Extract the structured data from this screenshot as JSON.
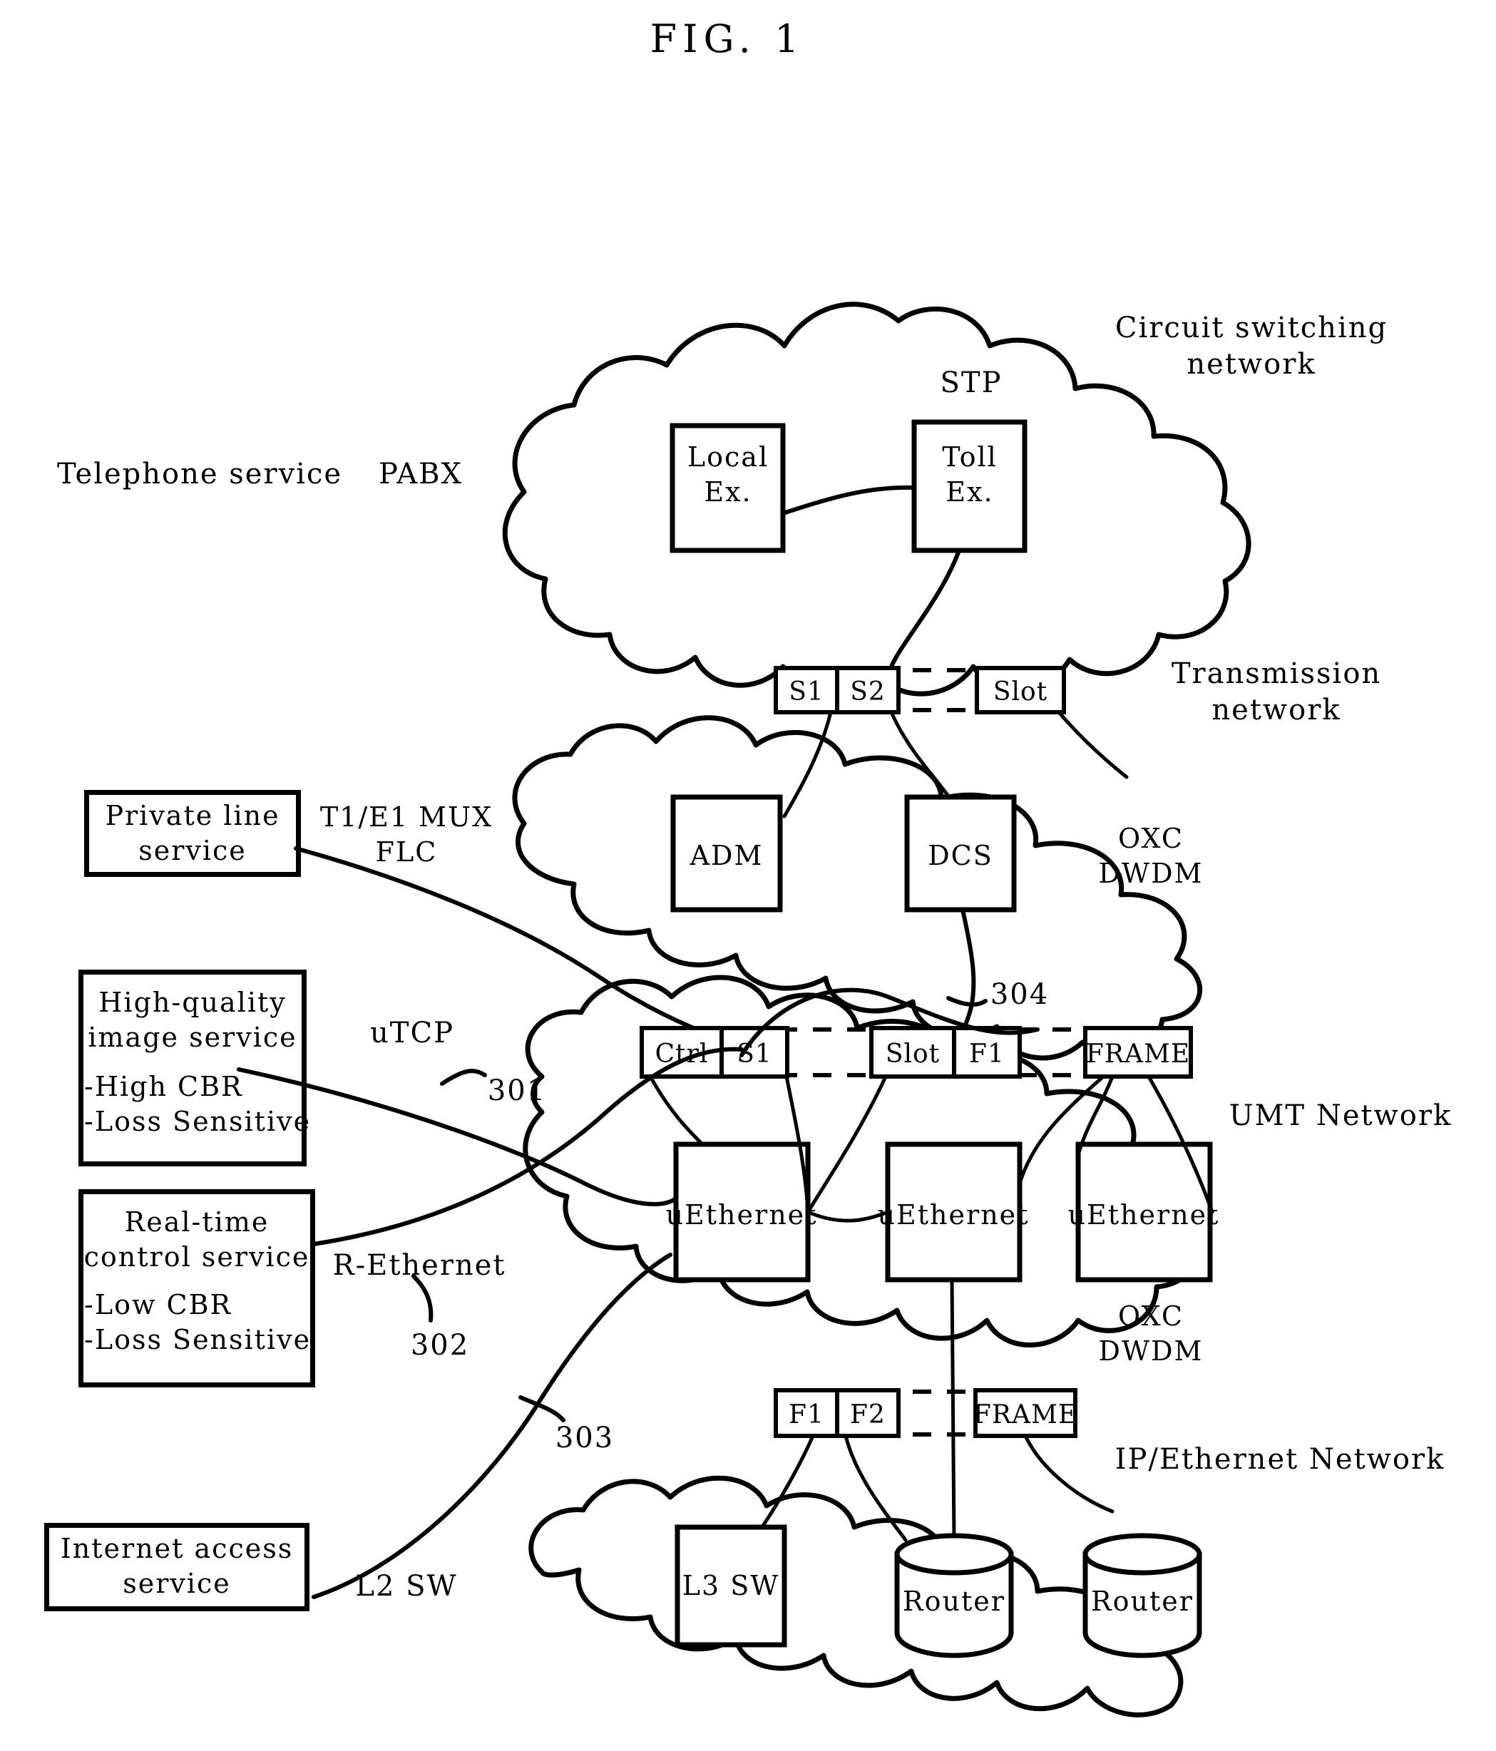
{
  "figure": {
    "title": "FIG. 1"
  },
  "labels": {
    "circuit_switching_network": "Circuit switching\nnetwork",
    "telephone_service": "Telephone service",
    "pabx": "PABX",
    "stp": "STP",
    "transmission_network": "Transmission\nnetwork",
    "t1e1_mux_flc": "T1/E1 MUX\nFLC",
    "oxc_dwdm_transmission": "OXC\nDWDM",
    "utcp": "uTCP",
    "r_ethernet": "R-Ethernet",
    "umt_network": "UMT Network",
    "oxc_dwdm_umt": "OXC\nDWDM",
    "ip_ethernet_network": "IP/Ethernet Network",
    "l2_sw": "L2 SW"
  },
  "reference_numbers": {
    "r301": "301",
    "r302": "302",
    "r303": "303",
    "r304": "304"
  },
  "service_boxes": [
    {
      "name": "private-line-service",
      "lines": "Private line\nservice"
    },
    {
      "name": "high-quality-image-service",
      "title": "High-quality\nimage service",
      "bullets": "-High CBR\n-Loss Sensitive"
    },
    {
      "name": "real-time-control-service",
      "title": "Real-time\ncontrol service",
      "bullets": "-Low CBR\n-Loss Sensitive"
    },
    {
      "name": "internet-access-service",
      "lines": "Internet access\nservice"
    }
  ],
  "circuit_nodes": [
    {
      "name": "local-exchange",
      "label": "Local\nEx."
    },
    {
      "name": "toll-exchange",
      "label": "Toll\nEx."
    }
  ],
  "transmission_nodes": [
    {
      "name": "adm",
      "label": "ADM"
    },
    {
      "name": "dcs",
      "label": "DCS"
    }
  ],
  "umt_nodes": [
    {
      "name": "uethernet-1",
      "label": "uEthernet"
    },
    {
      "name": "uethernet-2",
      "label": "uEthernet"
    },
    {
      "name": "uethernet-3",
      "label": "uEthernet"
    }
  ],
  "ip_nodes": [
    {
      "name": "l3-sw",
      "label": "L3 SW"
    },
    {
      "name": "router-1",
      "label": "Router"
    },
    {
      "name": "router-2",
      "label": "Router"
    }
  ],
  "frame_bars": {
    "transmission": {
      "cells": [
        "S1",
        "S2"
      ],
      "tail": "Slot"
    },
    "umt": {
      "group_a": [
        "Ctrl",
        "S1"
      ],
      "group_b": [
        "Slot",
        "F1"
      ],
      "tail": "FRAME"
    },
    "ip": {
      "cells": [
        "F1",
        "F2"
      ],
      "tail": "FRAME"
    }
  },
  "colors": {
    "ink": "#000000",
    "paper": "#ffffff"
  }
}
